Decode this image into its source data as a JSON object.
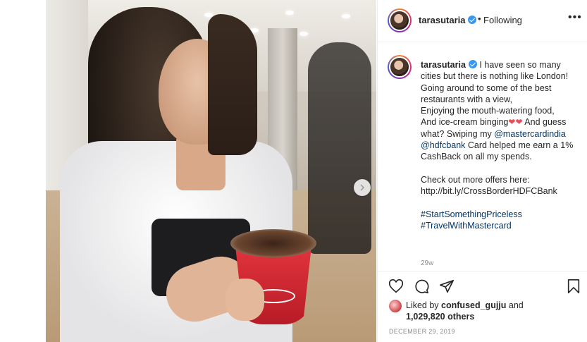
{
  "header": {
    "username": "tarasutaria",
    "separator": "•",
    "follow_status": "Following",
    "more_label": "•••"
  },
  "caption": {
    "username": "tarasutaria",
    "line1": "I have seen so many cities but there is nothing like London!",
    "line2": "Going around to some of the best restaurants with a view,",
    "line3": "Enjoying the mouth-watering food,",
    "line4a": "And ice-cream binging",
    "line4b": "And guess what? Swiping my",
    "mention1": "@mastercardindia",
    "mention2": "@hdfcbank",
    "line5": "Card helped me earn a 1% CashBack on all my spends.",
    "line6": "Check out more offers here:",
    "link": "http://bit.ly/CrossBorderHDFCBank",
    "hashtag1": "#StartSomethingPriceless",
    "hashtag2": "#TravelWithMastercard",
    "time": "29w"
  },
  "likes": {
    "prefix": "Liked by",
    "user": "confused_gujju",
    "joiner": "and",
    "count": "1,029,820 others"
  },
  "date": "DECEMBER 29, 2019",
  "icons": {
    "like": "heart-icon",
    "comment": "comment-icon",
    "share": "share-icon",
    "save": "bookmark-icon",
    "next": "chevron-right-icon"
  }
}
